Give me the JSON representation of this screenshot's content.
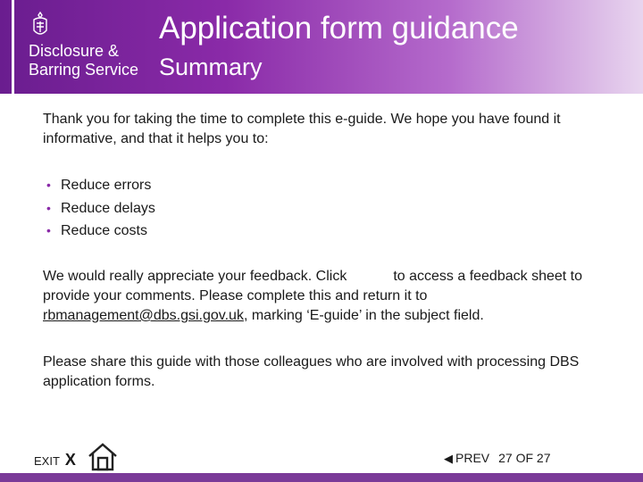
{
  "header": {
    "logo_line1": "Disclosure &",
    "logo_line2": "Barring Service",
    "title": "Application form guidance",
    "subtitle": "Summary"
  },
  "content": {
    "intro": "Thank you for taking the time to complete this e-guide.  We hope you have found it informative, and that it helps you to:",
    "bullets": [
      "Reduce errors",
      "Reduce delays",
      "Reduce costs"
    ],
    "feedback_before": "We would really appreciate your feedback.  Click",
    "feedback_after": "to access a feedback sheet to provide your comments. Please complete this and return it to",
    "email": "rbmanagement@dbs.gsi.gov.uk",
    "feedback_end": ", marking ‘E-guide’ in the subject field.",
    "share": "Please share this guide with those colleagues who are involved with processing DBS application forms."
  },
  "footer": {
    "exit_label": "EXIT",
    "exit_x": "X",
    "prev_label": "PREV",
    "page_indicator": "27 OF 27"
  },
  "colors": {
    "brand_purple": "#6a1d8f",
    "bullet": "#8a2aa8"
  },
  "icons": [
    "crest-icon",
    "home-icon",
    "prev-arrow-icon"
  ]
}
